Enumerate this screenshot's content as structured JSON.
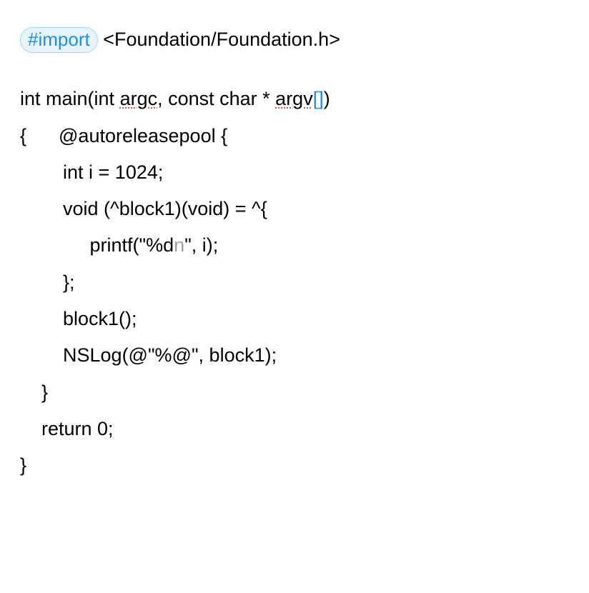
{
  "code": {
    "import_directive": "#import",
    "import_path": " <Foundation/Foundation.h>",
    "line2_a": "int main(int ",
    "line2_argc": "argc",
    "line2_b": ", const char * ",
    "line2_argv": "argv",
    "line2_bracket_open": "[",
    "line2_bracket_close": "]",
    "line2_paren": ")",
    "line3": "{      @autoreleasepool {",
    "line4": "        int i = 1024;",
    "line5": "        void (^block1)(void) = ^{",
    "line6_a": "             printf(\"%d",
    "line6_n": "n",
    "line6_b": "\", i);",
    "line7": "        };",
    "line8": "        block1();",
    "line9": "        NSLog(@\"%@\", block1);",
    "line10": "    }",
    "line11": "    return 0;",
    "line12": "}"
  }
}
